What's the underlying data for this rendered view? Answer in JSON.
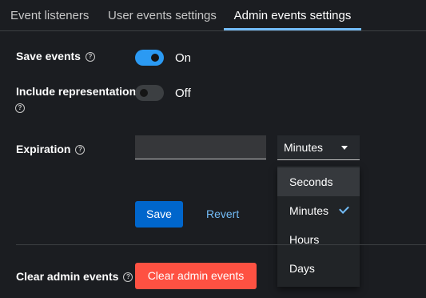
{
  "tabs": [
    {
      "label": "Event listeners"
    },
    {
      "label": "User events settings"
    },
    {
      "label": "Admin events settings"
    }
  ],
  "form": {
    "save_events": {
      "label": "Save events",
      "state": "On"
    },
    "include_representation": {
      "label": "Include representation",
      "state": "Off"
    },
    "expiration": {
      "label": "Expiration",
      "value": "",
      "unit": "Minutes"
    },
    "clear": {
      "label": "Clear admin events",
      "button": "Clear admin events"
    }
  },
  "unit_options": [
    "Seconds",
    "Minutes",
    "Hours",
    "Days"
  ],
  "actions": {
    "save": "Save",
    "revert": "Revert"
  },
  "icons": {
    "help": "?"
  },
  "colors": {
    "accent": "#73bcf7",
    "primary": "#0066cc",
    "danger": "#fe5142",
    "toggle_on": "#2b9af3"
  }
}
